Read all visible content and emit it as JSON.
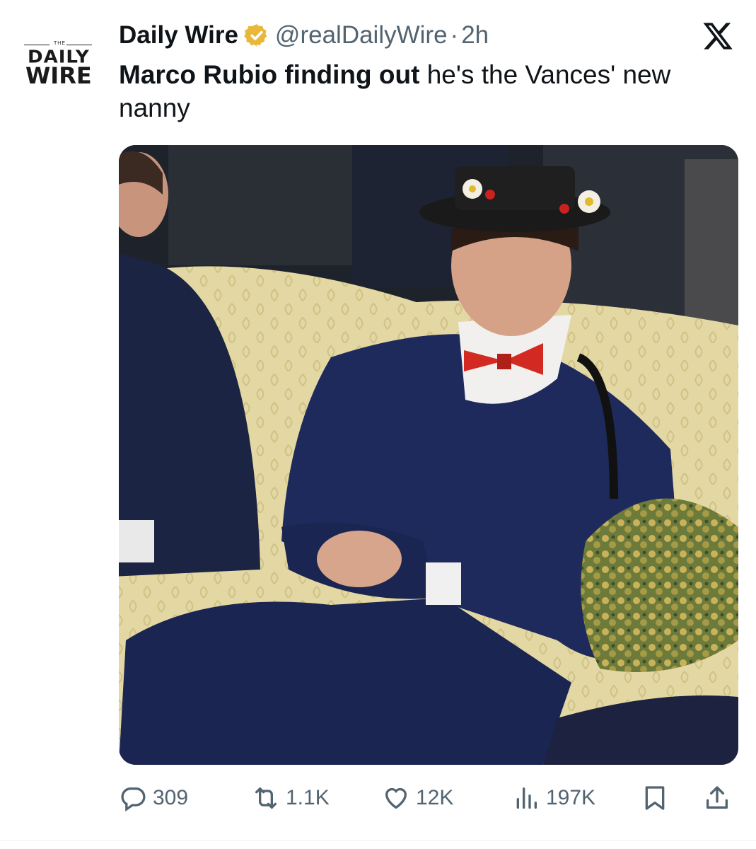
{
  "author": {
    "avatar_text_top": "DAILY",
    "avatar_text_bottom": "WIRE",
    "avatar_text_small": "THE",
    "display_name": "Daily Wire",
    "handle": "@realDailyWire",
    "separator": "·",
    "time": "2h",
    "verified_color": "#E8B83B"
  },
  "tweet": {
    "text_bold": "Marco Rubio finding out",
    "text_rest": " he's the Vances' new nanny"
  },
  "media": {
    "image_kind": "photo"
  },
  "actions": {
    "replies": "309",
    "reposts": "1.1K",
    "likes": "12K",
    "views": "197K"
  },
  "icons": [
    "x-logo-icon",
    "verified-badge-icon",
    "reply-icon",
    "repost-icon",
    "like-icon",
    "views-icon",
    "bookmark-icon",
    "share-icon"
  ],
  "colors": {
    "text": "#0f1419",
    "secondary": "#536471"
  }
}
